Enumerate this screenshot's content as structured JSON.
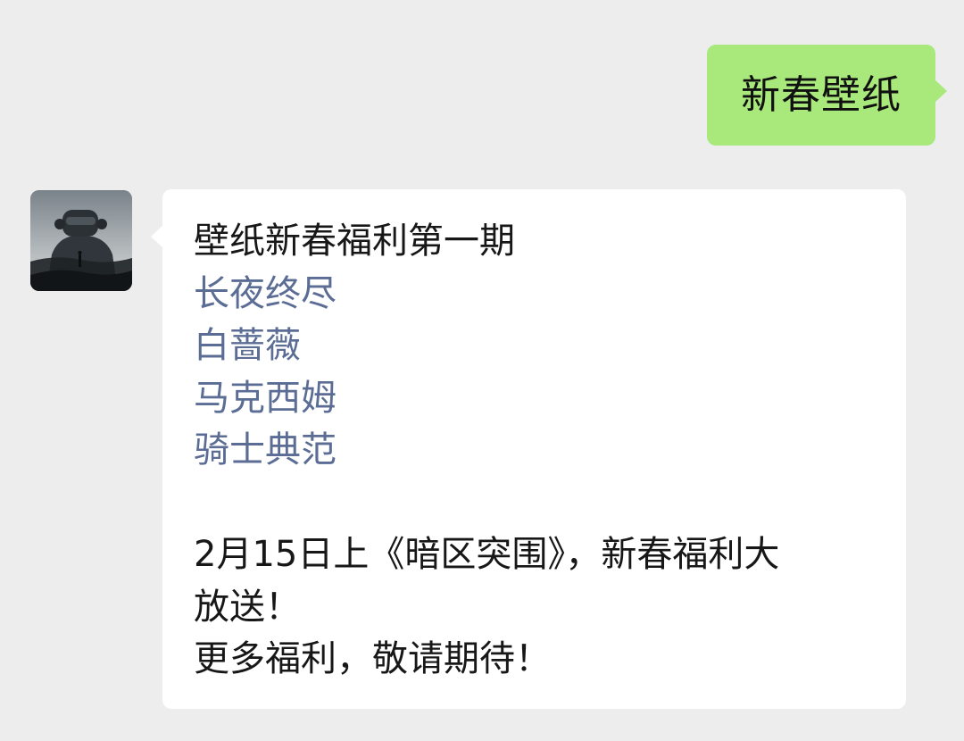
{
  "sent_message": {
    "text": "新春壁纸"
  },
  "received_message": {
    "title": "壁纸新春福利第一期",
    "links": [
      "长夜终尽",
      "白蔷薇",
      "马克西姆",
      "骑士典范"
    ],
    "body_lines": [
      "2月15日上《暗区突围》，新春福利大",
      "放送！",
      "更多福利，敬请期待！"
    ]
  },
  "colors": {
    "background": "#ededed",
    "sent_bubble": "#a9e97c",
    "received_bubble": "#ffffff",
    "link": "#5b6d95",
    "text": "#171717"
  }
}
